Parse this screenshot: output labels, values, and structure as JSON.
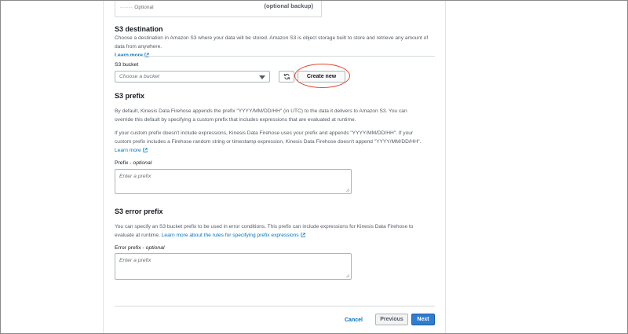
{
  "top_card": {
    "optional": "Optional",
    "backup": "(optional backup)"
  },
  "s3_destination": {
    "title": "S3 destination",
    "description": "Choose a destination in Amazon S3 where your data will be stored. Amazon S3 is object storage built to store and retrieve any amount of data from anywhere.",
    "learn_more": "Learn more",
    "bucket_label": "S3 bucket",
    "bucket_placeholder": "Choose a bucket",
    "create_new": "Create new"
  },
  "s3_prefix": {
    "title": "S3 prefix",
    "p1_line1": "By default, Kinesis Data Firehose appends the prefix \"YYYY/MM/DD/HH\" (in UTC) to the data it delivers to Amazon S3. You can",
    "p1_line2": "override this default by specifying a custom prefix that includes expressions that are evaluated at runtime.",
    "p2_line1": "If your custom prefix doesn't include expressions, Kinesis Data Firehose uses your prefix and appends \"YYYY/MM/DD/HH\". If your",
    "p2_line2": "custom prefix includes a Firehose random string or timestamp expression, Kinesis Data Firehose doesn't append \"YYYY/MM/DD/HH\".",
    "learn_more": "Learn more",
    "field_label": "Prefix",
    "field_optional": "optional",
    "field_placeholder": "Enter a prefix"
  },
  "s3_error_prefix": {
    "title": "S3 error prefix",
    "line1": "You can specify an S3 bucket prefix to be used in error conditions. This prefix can include expressions for Kinesis Data Firehose to",
    "line2_text": "evaluate at runtime.",
    "line2_link": "Learn more about the rules for specifying prefix expressions",
    "field_label": "Error prefix",
    "field_optional": "optional",
    "field_placeholder": "Enter a prefix"
  },
  "footer": {
    "cancel": "Cancel",
    "previous": "Previous",
    "next": "Next"
  },
  "colors": {
    "link": "#0073bb",
    "primary_button": "#2f7dd1",
    "highlight_ring": "#e8472f"
  }
}
